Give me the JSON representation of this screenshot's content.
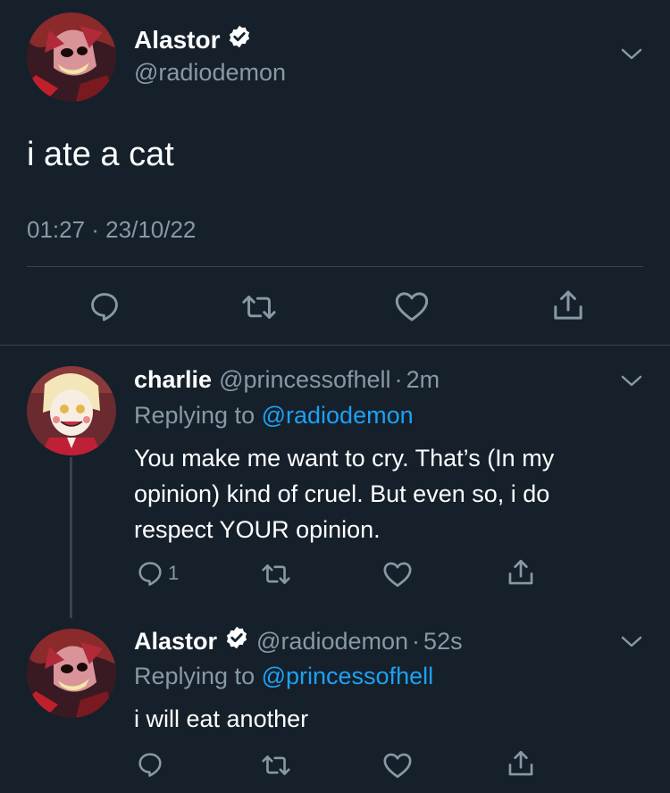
{
  "main_tweet": {
    "name": "Alastor",
    "handle": "@radiodemon",
    "text": "i ate a cat",
    "timestamp": "01:27 · 23/10/22"
  },
  "replies": [
    {
      "name": "charlie",
      "handle": "@princessofhell",
      "separator": "·",
      "time": "2m",
      "replying_prefix": "Replying to",
      "replying_to": "@radiodemon",
      "text": "You make me want to cry. That’s (In my opinion) kind of cruel. But even so, i do respect YOUR opinion.",
      "reply_count": "1"
    },
    {
      "name": "Alastor",
      "handle": "@radiodemon",
      "separator": "·",
      "time": "52s",
      "replying_prefix": "Replying to",
      "replying_to": "@princessofhell",
      "text": "i will eat another",
      "reply_count": ""
    }
  ],
  "colors": {
    "background": "#15202b",
    "secondary_text": "#8899a6",
    "link": "#1da1f2",
    "divider": "#38444d"
  }
}
